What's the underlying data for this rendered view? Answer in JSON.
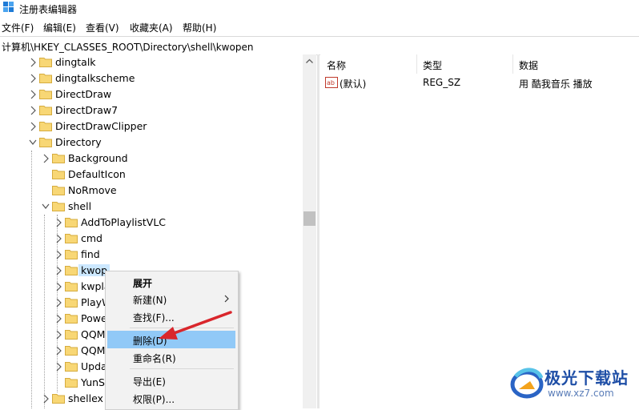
{
  "window": {
    "title": "注册表编辑器"
  },
  "menubar": [
    "文件(F)",
    "编辑(E)",
    "查看(V)",
    "收藏夹(A)",
    "帮助(H)"
  ],
  "address": "计算机\\HKEY_CLASSES_ROOT\\Directory\\shell\\kwopen",
  "tree": {
    "items": [
      {
        "label": "dingtalk"
      },
      {
        "label": "dingtalkscheme"
      },
      {
        "label": "DirectDraw"
      },
      {
        "label": "DirectDraw7"
      },
      {
        "label": "DirectDrawClipper"
      },
      {
        "label": "Directory"
      },
      {
        "label": "Background"
      },
      {
        "label": "DefaultIcon"
      },
      {
        "label": "NoRmove"
      },
      {
        "label": "shell"
      },
      {
        "label": "AddToPlaylistVLC"
      },
      {
        "label": "cmd"
      },
      {
        "label": "find"
      },
      {
        "label": "kwop"
      },
      {
        "label": "kwpla"
      },
      {
        "label": "PlayW"
      },
      {
        "label": "Powe"
      },
      {
        "label": "QQM"
      },
      {
        "label": "QQM"
      },
      {
        "label": "Upda"
      },
      {
        "label": "YunS"
      },
      {
        "label": "shellex"
      }
    ]
  },
  "list": {
    "columns": [
      "名称",
      "类型",
      "数据"
    ],
    "rows": [
      {
        "name": "(默认)",
        "type": "REG_SZ",
        "data": "用 酷我音乐 播放",
        "icon": "string-value-icon"
      }
    ]
  },
  "context_menu": {
    "items": [
      "展开",
      "新建(N)",
      "查找(F)...",
      "删除(D)",
      "重命名(R)",
      "导出(E)",
      "权限(P)..."
    ],
    "highlighted": "删除(D)"
  },
  "watermark": {
    "title": "极光下载站",
    "url": "www.xz7.com"
  },
  "colors": {
    "selection": "#cce8ff",
    "menu_highlight": "#91c9f7",
    "folder": "#f8d775",
    "arrow": "#d9262c"
  }
}
